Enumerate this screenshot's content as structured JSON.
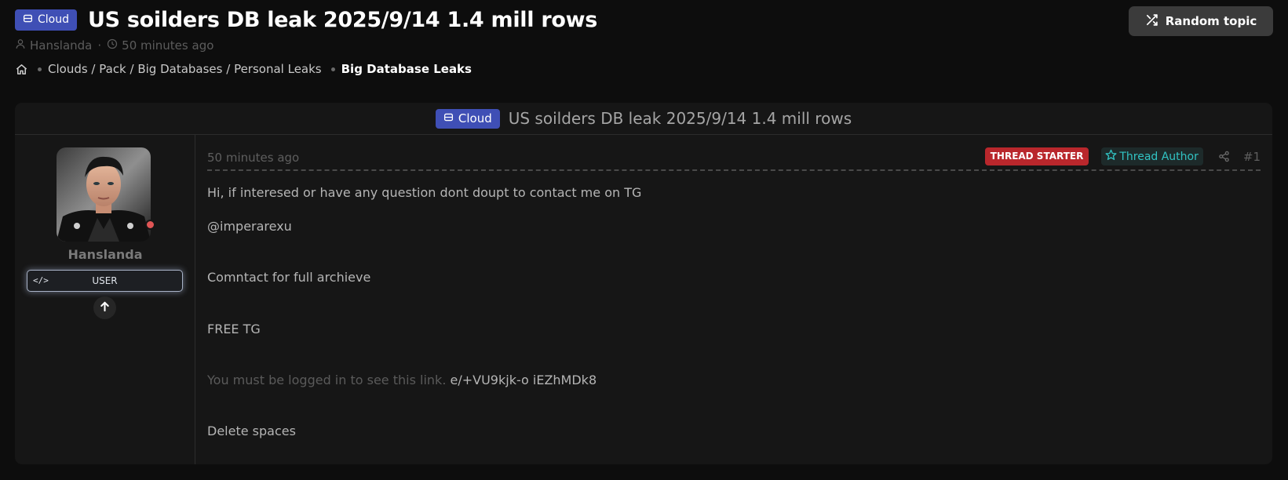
{
  "thread": {
    "prefix": "Cloud",
    "title": "US soilders DB leak 2025/9/14 1.4 mill rows",
    "author": "Hanslanda",
    "time": "50 minutes ago"
  },
  "header": {
    "random_topic_label": "Random topic",
    "meta_separator": "·"
  },
  "breadcrumb": {
    "items": [
      {
        "label": "Clouds / Pack / Big Databases / Personal Leaks"
      },
      {
        "label": "Big Database Leaks"
      }
    ]
  },
  "post": {
    "header_prefix": "Cloud",
    "header_title": "US soilders DB leak 2025/9/14 1.4 mill rows",
    "user": {
      "name": "Hanslanda",
      "role": "USER",
      "role_icon": "</>"
    },
    "time": "50 minutes ago",
    "badges": {
      "starter": "THREAD STARTER",
      "author": "Thread Author"
    },
    "number": "#1",
    "lines": {
      "l1": "Hi, if interesed or have any question dont doupt to contact me on TG",
      "l2": "@imperarexu",
      "l3": "Comntact for full archieve",
      "l4": "FREE TG",
      "l5_muted": "You must be logged in to see this link.",
      "l5_code": "e/+VU9kjk-o iEZhMDk8",
      "l6": "Delete spaces"
    }
  },
  "colors": {
    "prefix_bg": "#3f4fb5",
    "starter_bg": "#b9272c",
    "author_fg": "#31c3c3",
    "status_offline": "#e05555"
  },
  "icons": {
    "prefix": "database-icon",
    "random": "shuffle-icon",
    "meta_user": "user-icon",
    "meta_time": "clock-icon",
    "home": "home-icon",
    "author_badge": "star-icon",
    "share": "share-icon",
    "reputation": "arrow-up-icon"
  }
}
